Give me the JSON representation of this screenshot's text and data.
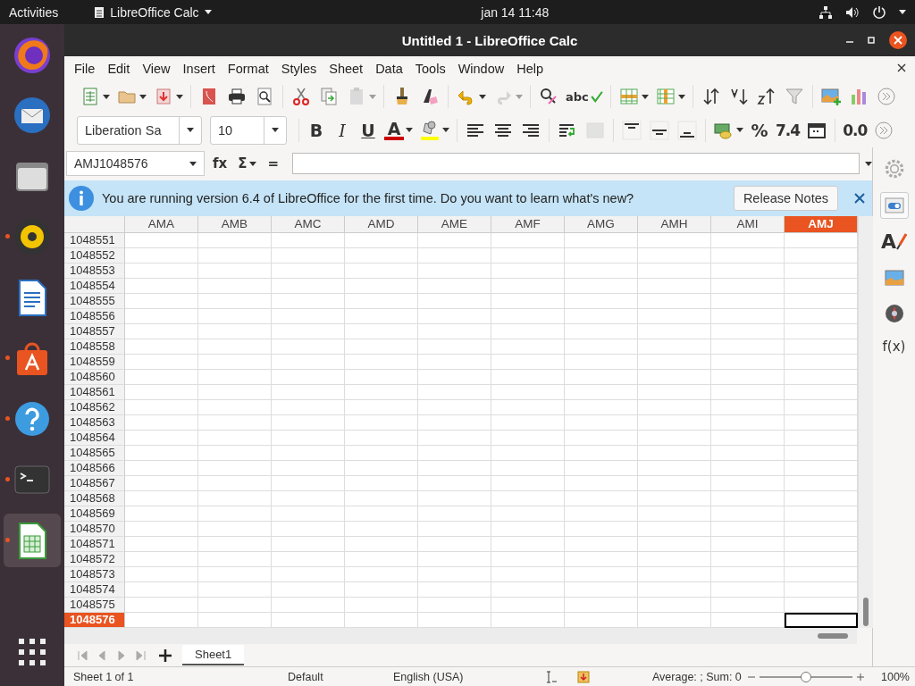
{
  "top_bar": {
    "activities": "Activities",
    "app_menu": "LibreOffice Calc",
    "clock": "jan 14  11:48"
  },
  "dock": [
    {
      "kind": "browser",
      "running": false,
      "selected": false
    },
    {
      "kind": "mail",
      "running": false,
      "selected": false
    },
    {
      "kind": "files",
      "running": false,
      "selected": false
    },
    {
      "kind": "music",
      "running": true,
      "selected": false
    },
    {
      "kind": "writer",
      "running": false,
      "selected": false
    },
    {
      "kind": "software",
      "running": true,
      "selected": false
    },
    {
      "kind": "help",
      "running": true,
      "selected": false
    },
    {
      "kind": "terminal",
      "running": true,
      "selected": false
    },
    {
      "kind": "calc",
      "running": true,
      "selected": true
    },
    {
      "kind": "apps",
      "running": false,
      "selected": false
    }
  ],
  "window": {
    "title": "Untitled 1 - LibreOffice Calc"
  },
  "menu": [
    "File",
    "Edit",
    "View",
    "Insert",
    "Format",
    "Styles",
    "Sheet",
    "Data",
    "Tools",
    "Window",
    "Help"
  ],
  "standard_toolbar": [
    {
      "kind": "new",
      "dropdown": true,
      "disabled": false
    },
    {
      "kind": "open",
      "dropdown": true,
      "disabled": false
    },
    {
      "kind": "save",
      "dropdown": true,
      "disabled": false
    },
    {
      "kind": "separator"
    },
    {
      "kind": "pdf",
      "dropdown": false,
      "disabled": false
    },
    {
      "kind": "print",
      "dropdown": false,
      "disabled": false
    },
    {
      "kind": "preview",
      "dropdown": false,
      "disabled": false
    },
    {
      "kind": "separator"
    },
    {
      "kind": "cut",
      "dropdown": false,
      "disabled": false
    },
    {
      "kind": "copy",
      "dropdown": false,
      "disabled": false
    },
    {
      "kind": "paste",
      "dropdown": true,
      "disabled": true
    },
    {
      "kind": "separator"
    },
    {
      "kind": "clone",
      "dropdown": false,
      "disabled": false
    },
    {
      "kind": "clear",
      "dropdown": false,
      "disabled": false
    },
    {
      "kind": "separator"
    },
    {
      "kind": "undo",
      "dropdown": true,
      "disabled": false
    },
    {
      "kind": "redo",
      "dropdown": true,
      "disabled": true
    },
    {
      "kind": "separator"
    },
    {
      "kind": "find",
      "dropdown": false,
      "disabled": false
    },
    {
      "kind": "spell",
      "label": "abc",
      "dropdown": false,
      "disabled": false
    },
    {
      "kind": "separator"
    },
    {
      "kind": "rows",
      "dropdown": true,
      "disabled": false
    },
    {
      "kind": "cols",
      "dropdown": true,
      "disabled": false
    },
    {
      "kind": "separator"
    },
    {
      "kind": "sort",
      "dropdown": false,
      "disabled": false
    },
    {
      "kind": "sort_asc",
      "dropdown": false,
      "disabled": false
    },
    {
      "kind": "sort_desc",
      "dropdown": false,
      "disabled": false
    },
    {
      "kind": "filter",
      "dropdown": false,
      "disabled": false
    },
    {
      "kind": "separator"
    },
    {
      "kind": "image",
      "dropdown": false,
      "disabled": false
    },
    {
      "kind": "chart",
      "dropdown": false,
      "disabled": false
    },
    {
      "kind": "more",
      "dropdown": false,
      "disabled": false
    }
  ],
  "formatting_toolbar": [
    {
      "kind": "font_name",
      "label": "Liberation Sa",
      "dropdown": true,
      "disabled": false
    },
    {
      "kind": "font_size",
      "label": "10",
      "dropdown": true,
      "disabled": false
    },
    {
      "kind": "separator"
    },
    {
      "kind": "bold",
      "label": "B",
      "dropdown": false,
      "disabled": false
    },
    {
      "kind": "italic",
      "label": "I",
      "dropdown": false,
      "disabled": false
    },
    {
      "kind": "underline",
      "label": "U",
      "dropdown": false,
      "disabled": false
    },
    {
      "kind": "font_color",
      "label": "A",
      "dropdown": true,
      "disabled": false
    },
    {
      "kind": "highlight",
      "dropdown": true,
      "disabled": false
    },
    {
      "kind": "separator"
    },
    {
      "kind": "align_left",
      "dropdown": false,
      "disabled": false
    },
    {
      "kind": "align_center",
      "dropdown": false,
      "disabled": false
    },
    {
      "kind": "align_right",
      "dropdown": false,
      "disabled": false
    },
    {
      "kind": "separator"
    },
    {
      "kind": "wrap",
      "dropdown": false,
      "disabled": false
    },
    {
      "kind": "merge",
      "dropdown": false,
      "disabled": true
    },
    {
      "kind": "separator"
    },
    {
      "kind": "align_top",
      "dropdown": false,
      "disabled": false
    },
    {
      "kind": "align_middle",
      "dropdown": false,
      "disabled": false
    },
    {
      "kind": "align_bottom",
      "dropdown": false,
      "disabled": false
    },
    {
      "kind": "separator"
    },
    {
      "kind": "currency",
      "dropdown": true,
      "disabled": false
    },
    {
      "kind": "percent",
      "label": "%",
      "dropdown": false,
      "disabled": false
    },
    {
      "kind": "number",
      "label": "7.4",
      "dropdown": false,
      "disabled": false
    },
    {
      "kind": "date",
      "dropdown": false,
      "disabled": false
    },
    {
      "kind": "separator"
    },
    {
      "kind": "decimal",
      "label": "0.0",
      "dropdown": false,
      "disabled": false
    },
    {
      "kind": "more",
      "dropdown": false,
      "disabled": false
    }
  ],
  "formula_bar": {
    "name_box": "AMJ1048576",
    "function_wizard": "fx",
    "sum": "Σ",
    "equals": "="
  },
  "infobar": {
    "message": "You are running version 6.4 of LibreOffice for the first time. Do you want to learn what's new?",
    "button": "Release Notes"
  },
  "sidebar": [
    {
      "kind": "properties",
      "selected": false
    },
    {
      "kind": "page",
      "selected": true
    },
    {
      "kind": "styles",
      "label": "A",
      "selected": false
    },
    {
      "kind": "gallery",
      "selected": false
    },
    {
      "kind": "navigator",
      "selected": false
    },
    {
      "kind": "functions",
      "label": "f(x)",
      "selected": false
    }
  ],
  "columns": [
    {
      "label": "AMA",
      "selected": false
    },
    {
      "label": "AMB",
      "selected": false
    },
    {
      "label": "AMC",
      "selected": false
    },
    {
      "label": "AMD",
      "selected": false
    },
    {
      "label": "AME",
      "selected": false
    },
    {
      "label": "AMF",
      "selected": false
    },
    {
      "label": "AMG",
      "selected": false
    },
    {
      "label": "AMH",
      "selected": false
    },
    {
      "label": "AMI",
      "selected": false
    },
    {
      "label": "AMJ",
      "selected": true
    }
  ],
  "rows": [
    {
      "label": "1048551",
      "selected": false
    },
    {
      "label": "1048552",
      "selected": false
    },
    {
      "label": "1048553",
      "selected": false
    },
    {
      "label": "1048554",
      "selected": false
    },
    {
      "label": "1048555",
      "selected": false
    },
    {
      "label": "1048556",
      "selected": false
    },
    {
      "label": "1048557",
      "selected": false
    },
    {
      "label": "1048558",
      "selected": false
    },
    {
      "label": "1048559",
      "selected": false
    },
    {
      "label": "1048560",
      "selected": false
    },
    {
      "label": "1048561",
      "selected": false
    },
    {
      "label": "1048562",
      "selected": false
    },
    {
      "label": "1048563",
      "selected": false
    },
    {
      "label": "1048564",
      "selected": false
    },
    {
      "label": "1048565",
      "selected": false
    },
    {
      "label": "1048566",
      "selected": false
    },
    {
      "label": "1048567",
      "selected": false
    },
    {
      "label": "1048568",
      "selected": false
    },
    {
      "label": "1048569",
      "selected": false
    },
    {
      "label": "1048570",
      "selected": false
    },
    {
      "label": "1048571",
      "selected": false
    },
    {
      "label": "1048572",
      "selected": false
    },
    {
      "label": "1048573",
      "selected": false
    },
    {
      "label": "1048574",
      "selected": false
    },
    {
      "label": "1048575",
      "selected": false
    },
    {
      "label": "1048576",
      "selected": true
    }
  ],
  "sheet_tabs": [
    {
      "label": "Sheet1",
      "selected": true
    }
  ],
  "status_bar": {
    "sheet": "Sheet 1 of 1",
    "page_style": "Default",
    "language": "English (USA)",
    "summary": "Average: ; Sum: 0",
    "zoom": {
      "level": 0.5
    },
    "zoom_reading": "100%"
  }
}
